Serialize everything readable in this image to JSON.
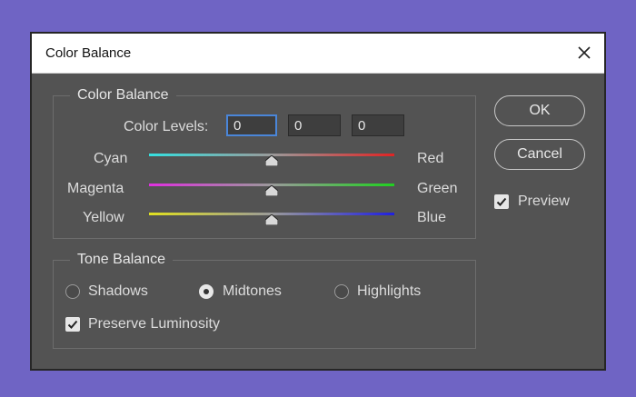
{
  "window": {
    "title": "Color Balance"
  },
  "color_balance": {
    "legend": "Color Balance",
    "levels_label": "Color Levels:",
    "levels": [
      "0",
      "0",
      "0"
    ],
    "sliders": [
      {
        "left": "Cyan",
        "right": "Red",
        "left_color": "#35e0e0",
        "right_color": "#e02424",
        "value": 0
      },
      {
        "left": "Magenta",
        "right": "Green",
        "left_color": "#e030e0",
        "right_color": "#20d020",
        "value": 0
      },
      {
        "left": "Yellow",
        "right": "Blue",
        "left_color": "#e0e020",
        "right_color": "#2020e0",
        "value": 0
      }
    ]
  },
  "tone_balance": {
    "legend": "Tone Balance",
    "options": [
      "Shadows",
      "Midtones",
      "Highlights"
    ],
    "selected": "Midtones",
    "preserve_luminosity_label": "Preserve Luminosity",
    "preserve_luminosity": true
  },
  "buttons": {
    "ok": "OK",
    "cancel": "Cancel"
  },
  "preview": {
    "label": "Preview",
    "checked": true
  }
}
